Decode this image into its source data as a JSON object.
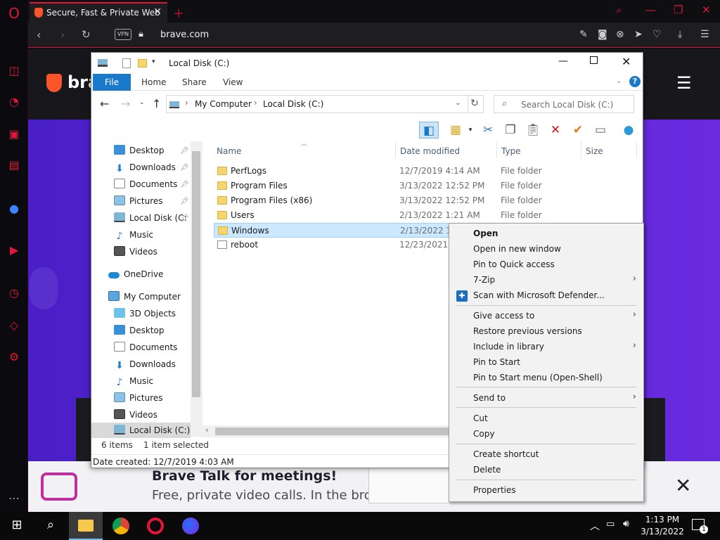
{
  "browser": {
    "tab_title": "Secure, Fast & Private Web",
    "url": "brave.com",
    "vpn_badge": "VPN",
    "accent_color": "#e0173a"
  },
  "brave_page": {
    "logo_partial": "bra",
    "banner_title": "Brave Talk for meetings!",
    "banner_subtitle": "Free, private video calls. In the brow"
  },
  "explorer": {
    "title": "Local Disk (C:)",
    "ribbon_tabs": [
      "File",
      "Home",
      "Share",
      "View"
    ],
    "breadcrumb": [
      "My Computer",
      "Local Disk (C:)"
    ],
    "search_placeholder": "Search Local Disk (C:)",
    "columns": [
      "Name",
      "Date modified",
      "Type",
      "Size"
    ],
    "nav_items": [
      {
        "label": "Desktop",
        "icon": "desktop-icon",
        "pinned": true
      },
      {
        "label": "Downloads",
        "icon": "download-icon",
        "pinned": true
      },
      {
        "label": "Documents",
        "icon": "documents-icon",
        "pinned": true
      },
      {
        "label": "Pictures",
        "icon": "pictures-icon",
        "pinned": true
      },
      {
        "label": "Local Disk (C:",
        "icon": "drive-icon",
        "pinned": true
      },
      {
        "label": "Music",
        "icon": "music-icon",
        "pinned": false
      },
      {
        "label": "Videos",
        "icon": "videos-icon",
        "pinned": false
      },
      {
        "label": "OneDrive",
        "icon": "onedrive-icon",
        "pinned": false
      },
      {
        "label": "My Computer",
        "icon": "computer-icon",
        "pinned": false
      },
      {
        "label": "3D Objects",
        "icon": "3d-objects-icon",
        "pinned": false
      },
      {
        "label": "Desktop",
        "icon": "desktop-icon",
        "pinned": false
      },
      {
        "label": "Documents",
        "icon": "documents-icon",
        "pinned": false
      },
      {
        "label": "Downloads",
        "icon": "download-icon",
        "pinned": false
      },
      {
        "label": "Music",
        "icon": "music-icon",
        "pinned": false
      },
      {
        "label": "Pictures",
        "icon": "pictures-icon",
        "pinned": false
      },
      {
        "label": "Videos",
        "icon": "videos-icon",
        "pinned": false
      },
      {
        "label": "Local Disk (C:)",
        "icon": "drive-icon",
        "pinned": false
      }
    ],
    "files": [
      {
        "name": "PerfLogs",
        "date": "12/7/2019 4:14 AM",
        "type": "File folder"
      },
      {
        "name": "Program Files",
        "date": "3/13/2022 12:52 PM",
        "type": "File folder"
      },
      {
        "name": "Program Files (x86)",
        "date": "3/13/2022 12:52 PM",
        "type": "File folder"
      },
      {
        "name": "Users",
        "date": "2/13/2022 1:21 AM",
        "type": "File folder"
      },
      {
        "name": "Windows",
        "date": "2/13/2022 1:2",
        "type": ""
      },
      {
        "name": "reboot",
        "date": "12/23/2021 12",
        "type": ""
      }
    ],
    "selected_file": "Windows",
    "status_count": "6 items",
    "status_selected": "1 item selected",
    "info_text": "Date created: 12/7/2019 4:03 AM"
  },
  "context_menu": {
    "items": [
      {
        "label": "Open",
        "bold": true,
        "submenu": false
      },
      {
        "label": "Open in new window",
        "submenu": false
      },
      {
        "label": "Pin to Quick access",
        "submenu": false
      },
      {
        "label": "7-Zip",
        "submenu": true
      },
      {
        "label": "Scan with Microsoft Defender...",
        "submenu": false,
        "icon": "defender-icon"
      },
      {
        "label": "Give access to",
        "submenu": true
      },
      {
        "label": "Restore previous versions",
        "submenu": false
      },
      {
        "label": "Include in library",
        "submenu": true
      },
      {
        "label": "Pin to Start",
        "submenu": false
      },
      {
        "label": "Pin to Start menu (Open-Shell)",
        "submenu": false
      },
      {
        "label": "Send to",
        "submenu": true
      },
      {
        "label": "Cut",
        "submenu": false
      },
      {
        "label": "Copy",
        "submenu": false
      },
      {
        "label": "Create shortcut",
        "submenu": false
      },
      {
        "label": "Delete",
        "submenu": false
      },
      {
        "label": "Properties",
        "submenu": false
      }
    ]
  },
  "taskbar": {
    "time": "1:13 PM",
    "date": "3/13/2022",
    "notification_count": "1"
  }
}
